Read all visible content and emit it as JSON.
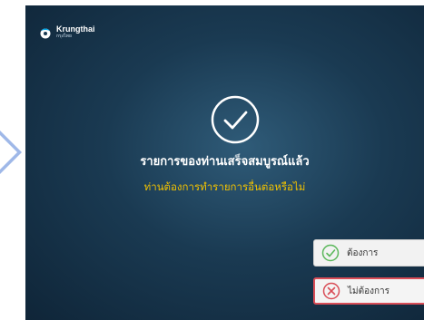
{
  "brand": {
    "name": "Krungthai",
    "sub": "กรุงไทย",
    "accent": "#00a4e4"
  },
  "message": {
    "title": "รายการของท่านเสร็จสมบูรณ์แล้ว",
    "question": "ท่านต้องการทำรายการอื่นต่อหรือไม่"
  },
  "buttons": {
    "yes_label": "ต้องการ",
    "no_label": "ไม่ต้องการ"
  },
  "colors": {
    "question_text": "#f2c200",
    "yes_icon": "#5cb85c",
    "no_icon": "#d94d57"
  }
}
